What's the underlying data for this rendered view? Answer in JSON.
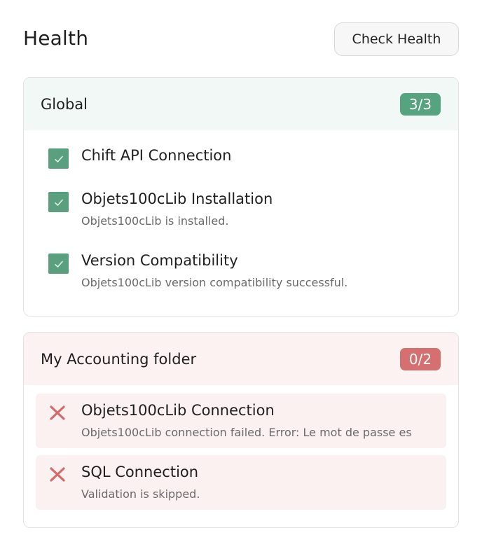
{
  "header": {
    "title": "Health",
    "check_button_label": "Check Health"
  },
  "global": {
    "title": "Global",
    "badge": "3/3",
    "badge_color": "#56a37f",
    "items": [
      {
        "title": "Chift API Connection",
        "description": "",
        "status": "passed",
        "icon": "checkbox-checked-icon"
      },
      {
        "title": "Objets100cLib Installation",
        "description": "Objets100cLib is installed.",
        "status": "passed",
        "icon": "checkbox-checked-icon"
      },
      {
        "title": "Version Compatibility",
        "description": "Objets100cLib version compatibility successful.",
        "status": "passed",
        "icon": "checkbox-checked-icon"
      }
    ]
  },
  "folder": {
    "title": "My Accounting folder",
    "badge": "0/2",
    "badge_color": "#d66f6f",
    "items": [
      {
        "title": "Objets100cLib Connection",
        "description": "Objets100cLib connection failed. Error: Le mot de passe es",
        "status": "failed",
        "icon": "close-x-icon"
      },
      {
        "title": "SQL Connection",
        "description": "Validation is skipped.",
        "status": "failed",
        "icon": "close-x-icon"
      }
    ]
  }
}
